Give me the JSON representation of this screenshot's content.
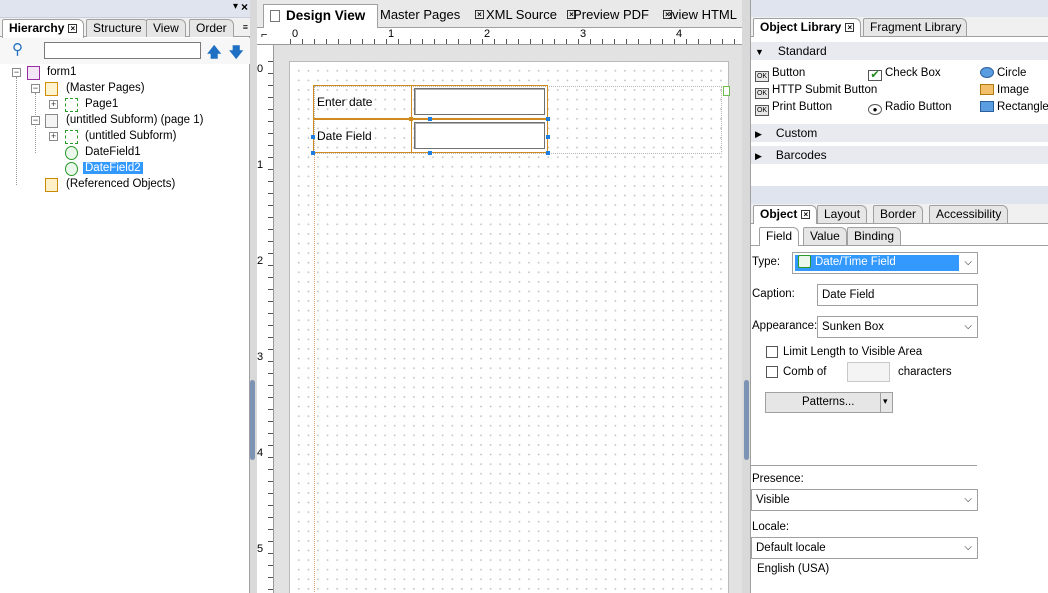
{
  "left_panel": {
    "tabs": [
      "Hierarchy",
      "Structure",
      "View",
      "Order"
    ],
    "tree": {
      "form": "form1",
      "master_pages": "(Master Pages)",
      "page1": "Page1",
      "subform_page": "(untitled Subform) (page 1)",
      "subform": "(untitled Subform)",
      "datefield1": "DateField1",
      "datefield2": "DateField2",
      "referenced": "(Referenced Objects)"
    }
  },
  "center": {
    "doc_tabs": [
      "Design View",
      "Master Pages",
      "XML Source",
      "Preview PDF",
      "Preview HTML"
    ],
    "ruler_top": [
      "0",
      "1",
      "2",
      "3",
      "4"
    ],
    "ruler_left": [
      "0",
      "1",
      "2",
      "3",
      "4",
      "5"
    ],
    "fields": [
      {
        "caption": "Enter date"
      },
      {
        "caption": "Date Field"
      }
    ]
  },
  "right_panel": {
    "library_tabs": [
      "Object Library",
      "Fragment Library"
    ],
    "sections": {
      "standard": "Standard",
      "custom": "Custom",
      "barcodes": "Barcodes"
    },
    "library_items": [
      "Button",
      "Check Box",
      "Circle",
      "HTTP Submit Button",
      "Image",
      "Print Button",
      "Radio Button",
      "Rectangle"
    ],
    "object_tabs": [
      "Object",
      "Layout",
      "Border",
      "Accessibility"
    ],
    "sub_tabs": [
      "Field",
      "Value",
      "Binding"
    ],
    "props": {
      "type_label": "Type:",
      "type_value": "Date/Time Field",
      "caption_label": "Caption:",
      "caption_value": "Date Field",
      "appearance_label": "Appearance:",
      "appearance_value": "Sunken Box",
      "limit_length": "Limit Length to Visible Area",
      "comb_of": "Comb of",
      "characters": "characters",
      "patterns": "Patterns...",
      "presence_label": "Presence:",
      "presence_value": "Visible",
      "locale_label": "Locale:",
      "locale_value": "Default locale",
      "locale_hint": "English (USA)"
    }
  }
}
